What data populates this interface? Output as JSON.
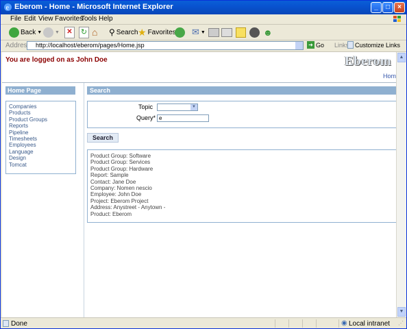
{
  "window": {
    "title": "Eberom - Home - Microsoft Internet Explorer"
  },
  "menu": [
    "File",
    "Edit",
    "View",
    "Favorites",
    "Tools",
    "Help"
  ],
  "toolbar": {
    "back": "Back",
    "search": "Search",
    "favorites": "Favorites"
  },
  "address": {
    "label": "Address",
    "url": "http://localhost/eberom/pages/Home.jsp",
    "go": "Go",
    "links": "Links",
    "customize": "Customize Links"
  },
  "page": {
    "logged_in": "You are logged on as John Doe",
    "logo": "Eberom",
    "home_link": "Home",
    "left_header": "Home Page",
    "nav": [
      "Companies",
      "Products",
      "Product Groups",
      "Reports",
      "Pipeline",
      "Timesheets",
      "Employees",
      "Language",
      "Design",
      "Tomcat"
    ],
    "main_header": "Search",
    "topic_label": "Topic",
    "query_label": "Query*",
    "query_value": "e",
    "search_button": "Search",
    "results": [
      "Product Group: Software",
      "Product Group: Services",
      "Product Group: Hardware",
      "Report: Sample",
      "Contact: Jane Doe",
      "Company: Nomen nescio",
      "Employee: John Doe",
      "Project: Eberom Project",
      "Address: Anystreet - Anytown -",
      "Product: Eberom"
    ]
  },
  "status": {
    "text": "Done",
    "zone": "Local intranet"
  }
}
